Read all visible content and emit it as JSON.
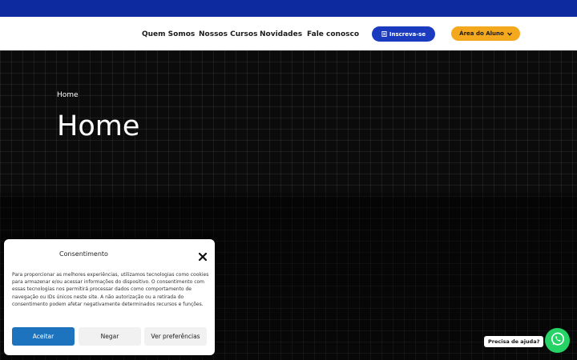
{
  "nav": {
    "links": [
      "Quem Somos",
      "Nossos Cursos",
      "Novidades",
      "Fale conosco"
    ],
    "inscreva_label": "Inscreva-se",
    "area_label": "Área do Aluno"
  },
  "hero": {
    "breadcrumb": "Home",
    "title": "Home"
  },
  "consent": {
    "title": "Consentimento",
    "text": "Para proporcionar as melhores experiências, utilizamos tecnologias como cookies para armazenar e/ou acessar informações do dispositivo. O consentimento com essas tecnologias nos permitirá processar dados como comportamento de navegação ou IDs únicos neste site. A não autorização ou a retirada do consentimento podem afetar negativamente determinados recursos e funções.",
    "accept_label": "Aceitar",
    "deny_label": "Negar",
    "prefs_label": "Ver preferências"
  },
  "help": {
    "bubble_text": "Precisa de ajuda?"
  },
  "colors": {
    "topbar": "#0d2a9e",
    "inscreva": "#1a3bbf",
    "area": "#f4a81e",
    "accept": "#1e73be",
    "whatsapp": "#25d366"
  }
}
